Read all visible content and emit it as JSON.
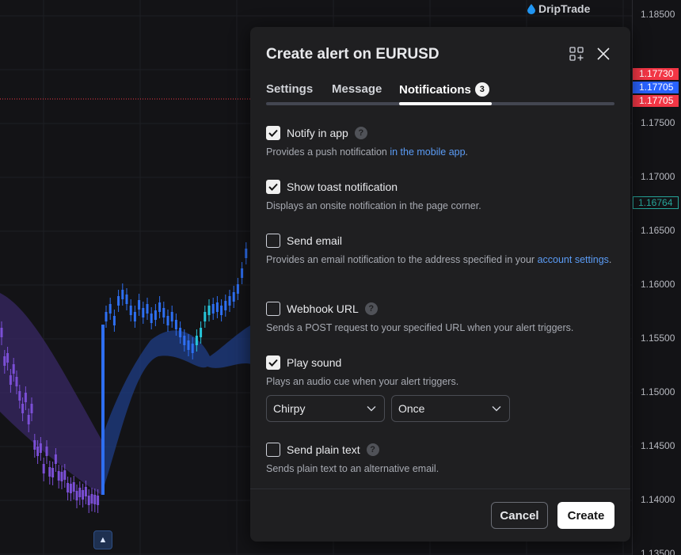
{
  "watermark": "DripTrade",
  "price_axis": {
    "labels": [
      "1.18500",
      "1.17500",
      "1.17000",
      "1.16500",
      "1.16000",
      "1.15500",
      "1.15000",
      "1.14500",
      "1.14000",
      "1.13500"
    ],
    "tags": [
      {
        "value": "1.17730",
        "color": "#f23645"
      },
      {
        "value": "1.17705",
        "color": "#2962ff"
      },
      {
        "value": "1.17705",
        "color": "#f23645"
      },
      {
        "value": "1.16764",
        "color": "#26a69a"
      }
    ]
  },
  "colors": {
    "accent": "#5b9cf6",
    "bull": "#2e6ff2",
    "bear": "#7b4fd6",
    "highlight": "#26c6da"
  },
  "dialog": {
    "title": "Create alert on EURUSD",
    "tabs": [
      {
        "label": "Settings"
      },
      {
        "label": "Message"
      },
      {
        "label": "Notifications",
        "badge": "3"
      }
    ],
    "options": [
      {
        "label": "Notify in app",
        "checked": true,
        "help": true,
        "desc": "Provides a push notification ",
        "link": "in the mobile app",
        "desc_after": "."
      },
      {
        "label": "Show toast notification",
        "checked": true,
        "help": false,
        "desc": "Displays an onsite notification in the page corner."
      },
      {
        "label": "Send email",
        "checked": false,
        "help": false,
        "desc": "Provides an email notification to the address specified in your ",
        "link": "account settings",
        "desc_after": "."
      },
      {
        "label": "Webhook URL",
        "checked": false,
        "help": true,
        "desc": "Sends a POST request to your specified URL when your alert triggers."
      },
      {
        "label": "Play sound",
        "checked": true,
        "help": false,
        "desc": "Plays an audio cue when your alert triggers."
      },
      {
        "label": "Send plain text",
        "checked": false,
        "help": true,
        "desc": "Sends plain text to an alternative email."
      }
    ],
    "sound_select": "Chirpy",
    "repeat_select": "Once",
    "cancel": "Cancel",
    "create": "Create"
  }
}
